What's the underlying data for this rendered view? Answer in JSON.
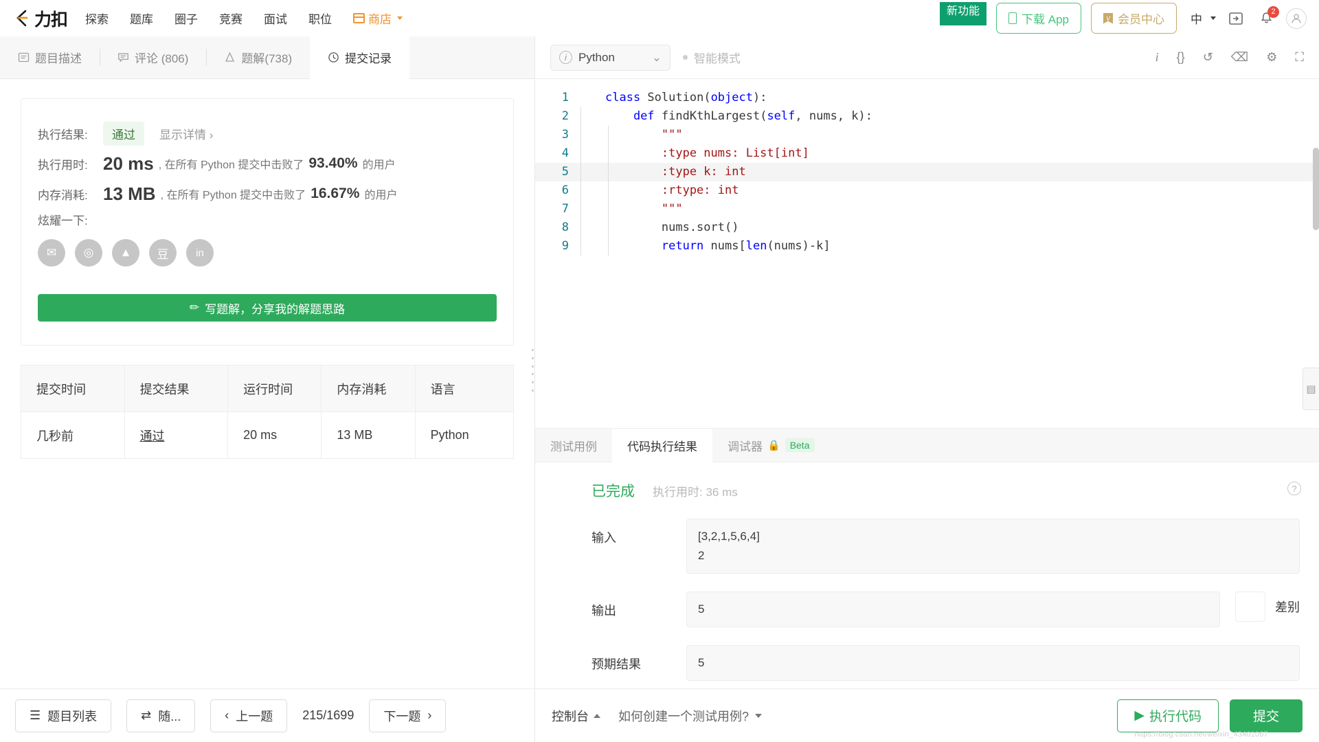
{
  "header": {
    "logo_text": "力扣",
    "nav": [
      {
        "label": "探索"
      },
      {
        "label": "题库"
      },
      {
        "label": "圈子"
      },
      {
        "label": "竞赛"
      },
      {
        "label": "面试"
      },
      {
        "label": "职位"
      },
      {
        "label": "商店"
      }
    ],
    "ribbon_label": "新功能",
    "download_app": "下载 App",
    "membership": "会员中心",
    "language": "中",
    "notification_count": "2",
    "colors": {
      "brand_orange": "#f0932b",
      "green": "#2eaa5c",
      "ribbon_green": "#0e9f6e",
      "gold": "#c9a86a",
      "notify_red": "#e74c3c"
    }
  },
  "left_panel": {
    "tabs": [
      {
        "label": "题目描述",
        "icon": "document-icon",
        "active": false
      },
      {
        "label": "评论 (806)",
        "icon": "comment-icon",
        "active": false
      },
      {
        "label": "题解(738)",
        "icon": "solution-icon",
        "active": false
      },
      {
        "label": "提交记录",
        "icon": "clock-icon",
        "active": true
      }
    ],
    "result_card": {
      "result_label": "执行结果:",
      "result_value": "通过",
      "detail_link": "显示详情",
      "runtime_label": "执行用时:",
      "runtime_value": "20 ms",
      "runtime_mid": ", 在所有 Python 提交中击败了",
      "runtime_pct": "93.40",
      "runtime_tail": "的用户",
      "memory_label": "内存消耗:",
      "memory_value": "13 MB",
      "memory_mid": ", 在所有 Python 提交中击败了",
      "memory_pct": "16.67",
      "memory_tail": "的用户",
      "share_label": "炫耀一下:",
      "share_icons": [
        {
          "name": "wechat-icon",
          "glyph": "✉"
        },
        {
          "name": "weibo-icon",
          "glyph": "◎"
        },
        {
          "name": "qq-icon",
          "glyph": "▲"
        },
        {
          "name": "douban-icon",
          "glyph": "豆"
        },
        {
          "name": "linkedin-icon",
          "glyph": "in"
        }
      ],
      "write_button": "写题解，分享我的解题思路"
    },
    "submissions_table": {
      "columns": [
        "提交时间",
        "提交结果",
        "运行时间",
        "内存消耗",
        "语言"
      ],
      "rows": [
        {
          "time": "几秒前",
          "result": "通过",
          "runtime": "20 ms",
          "memory": "13 MB",
          "language": "Python"
        }
      ]
    },
    "footer": {
      "problem_list": "题目列表",
      "random": "随...",
      "prev": "上一题",
      "counter": "215/1699",
      "next": "下一题"
    }
  },
  "editor": {
    "language": "Python",
    "smart_mode": "智能模式",
    "toolbar_icons": [
      {
        "name": "info-icon",
        "glyph": "i"
      },
      {
        "name": "format-braces-icon",
        "glyph": "{}"
      },
      {
        "name": "reset-icon",
        "glyph": "↺"
      },
      {
        "name": "terminal-icon",
        "glyph": "⌫"
      },
      {
        "name": "settings-icon",
        "glyph": "⚙"
      },
      {
        "name": "fullscreen-icon",
        "glyph": "⛶"
      }
    ],
    "code_lines": [
      {
        "n": "1",
        "indent": 0,
        "highlight": false,
        "tokens": [
          {
            "t": "class ",
            "c": "kw"
          },
          {
            "t": "Solution",
            "c": "fn"
          },
          {
            "t": "(",
            "c": ""
          },
          {
            "t": "object",
            "c": "bi"
          },
          {
            "t": "):",
            "c": ""
          }
        ]
      },
      {
        "n": "2",
        "indent": 1,
        "highlight": false,
        "tokens": [
          {
            "t": "    def ",
            "c": "kw"
          },
          {
            "t": "findKthLargest",
            "c": "fn"
          },
          {
            "t": "(",
            "c": ""
          },
          {
            "t": "self",
            "c": "bi"
          },
          {
            "t": ", nums, k):",
            "c": ""
          }
        ]
      },
      {
        "n": "3",
        "indent": 2,
        "highlight": false,
        "tokens": [
          {
            "t": "        \"\"\"",
            "c": "str"
          }
        ]
      },
      {
        "n": "4",
        "indent": 2,
        "highlight": false,
        "tokens": [
          {
            "t": "        :type nums: List[int]",
            "c": "str"
          }
        ]
      },
      {
        "n": "5",
        "indent": 2,
        "highlight": true,
        "tokens": [
          {
            "t": "        :type k: int",
            "c": "str"
          }
        ]
      },
      {
        "n": "6",
        "indent": 2,
        "highlight": false,
        "tokens": [
          {
            "t": "        :rtype: int",
            "c": "str"
          }
        ]
      },
      {
        "n": "7",
        "indent": 2,
        "highlight": false,
        "tokens": [
          {
            "t": "        \"\"\"",
            "c": "str"
          }
        ]
      },
      {
        "n": "8",
        "indent": 2,
        "highlight": false,
        "tokens": [
          {
            "t": "        nums.sort()",
            "c": ""
          }
        ]
      },
      {
        "n": "9",
        "indent": 2,
        "highlight": false,
        "tokens": [
          {
            "t": "        return ",
            "c": "kw"
          },
          {
            "t": "nums[",
            "c": ""
          },
          {
            "t": "len",
            "c": "bi"
          },
          {
            "t": "(nums)-k]",
            "c": ""
          }
        ]
      }
    ]
  },
  "bottom_panel": {
    "tabs": [
      {
        "label": "测试用例",
        "active": false
      },
      {
        "label": "代码执行结果",
        "active": true
      },
      {
        "label": "调试器",
        "active": false,
        "lock": true,
        "beta": "Beta"
      }
    ],
    "status": "已完成",
    "runtime_label": "执行用时:",
    "runtime_value": "36 ms",
    "input_label": "输入",
    "input_value": "[3,2,1,5,6,4]\n2",
    "output_label": "输出",
    "output_value": "5",
    "diff_label": "差别",
    "expected_label": "预期结果",
    "expected_value": "5"
  },
  "editor_footer": {
    "console": "控制台",
    "howto": "如何创建一个测试用例?",
    "run": "执行代码",
    "submit": "提交",
    "watermark": "https://blog.csdn.net/weixin_43401067"
  }
}
